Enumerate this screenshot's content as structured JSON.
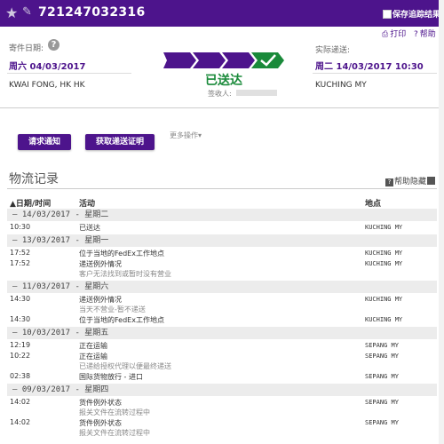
{
  "header": {
    "tracking_number": "721247032316",
    "save_label": "保存追踪结果"
  },
  "tools": {
    "print": "打印",
    "help": "帮助"
  },
  "ship": {
    "label": "寄件日期:",
    "date": "周六 04/03/2017",
    "origin": "KWAI FONG, HK HK"
  },
  "delivery": {
    "label": "实际递送:",
    "date": "周二 14/03/2017 10:30",
    "destination": "KUCHING MY"
  },
  "status": {
    "text": "已送达",
    "signed_label": "签收人:",
    "progress_steps": 4,
    "progress_done": 4,
    "color": "#1a8a3a"
  },
  "actions": {
    "request_notify": "请求通知",
    "get_proof": "获取递送证明",
    "more": "更多操作"
  },
  "history": {
    "title": "物流记录",
    "help": "帮助",
    "hide": "隐藏",
    "columns": {
      "datetime": "日期/时间",
      "activity": "活动",
      "location": "地点"
    },
    "groups": [
      {
        "date": "—  14/03/2017 - 星期二",
        "rows": [
          {
            "time": "10:30",
            "activity": "已送达",
            "sub": "",
            "location": "KUCHING MY"
          }
        ]
      },
      {
        "date": "—  13/03/2017 - 星期一",
        "rows": [
          {
            "time": "17:52",
            "activity": "位于当地的FedEx工作地点",
            "sub": "",
            "location": "KUCHING MY"
          },
          {
            "time": "17:52",
            "activity": "递送例外情况",
            "sub": "客户无法找到或暂时没有营业",
            "location": "KUCHING MY"
          }
        ]
      },
      {
        "date": "—  11/03/2017 - 星期六",
        "rows": [
          {
            "time": "14:30",
            "activity": "递送例外情况",
            "sub": "当天不营业-暂不递送",
            "location": "KUCHING MY"
          },
          {
            "time": "14:30",
            "activity": "位于当地的FedEx工作地点",
            "sub": "",
            "location": "KUCHING MY"
          }
        ]
      },
      {
        "date": "—  10/03/2017 - 星期五",
        "rows": [
          {
            "time": "12:19",
            "activity": "正在运输",
            "sub": "",
            "location": "SEPANG MY"
          },
          {
            "time": "10:22",
            "activity": "正在运输",
            "sub": "已递给授权代理以便最终递送",
            "location": "SEPANG MY"
          },
          {
            "time": "02:38",
            "activity": "国际货物放行 - 进口",
            "sub": "",
            "location": "SEPANG MY"
          }
        ]
      },
      {
        "date": "—  09/03/2017 - 星期四",
        "rows": [
          {
            "time": "14:02",
            "activity": "货件例外状态",
            "sub": "报关文件在流转过程中",
            "location": "SEPANG MY"
          },
          {
            "time": "14:02",
            "activity": "货件例外状态",
            "sub": "报关文件在流转过程中",
            "location": "SEPANG MY"
          }
        ]
      }
    ]
  },
  "colors": {
    "brand_purple": "#4d148c",
    "delivered_green": "#1a8a3a"
  }
}
